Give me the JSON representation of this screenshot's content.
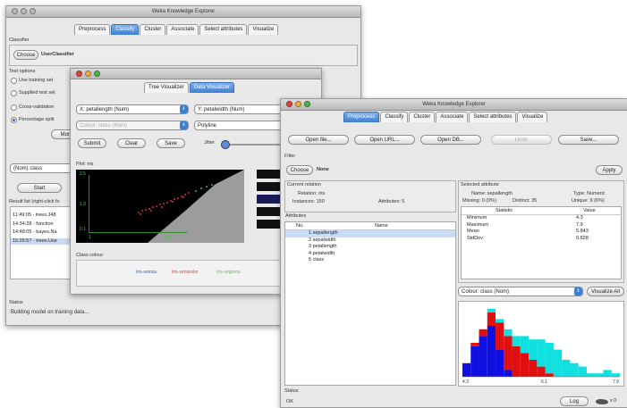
{
  "back_window": {
    "title": "Weka Knowledge Explorer",
    "tabs": [
      "Preprocess",
      "Classify",
      "Cluster",
      "Associate",
      "Select attributes",
      "Visualize"
    ],
    "active_tab": "Classify",
    "classifier_label": "Classifier",
    "choose_label": "Choose",
    "classifier_name": "UserClassifier",
    "test_options_label": "Test options",
    "test_options": [
      "Use training set",
      "Supplied test set",
      "Cross-validation",
      "Percentage split"
    ],
    "more_label": "More o",
    "class_select": "(Nom) class",
    "start_label": "Start",
    "result_list_label": "Result list (right-click fo",
    "results": [
      "11:49:05 - trees.J48",
      "14:34:28 - function",
      "14:48:05 - bayes.Na",
      "15:26:57 - trees.Use"
    ],
    "status_label": "Status",
    "status_text": "Building model on training data..."
  },
  "visualizer_window": {
    "tabs": [
      "Tree Visualizer",
      "Data Visualizer"
    ],
    "active_tab": "Data Visualizer",
    "x_select": "X: petallength (Num)",
    "y_select": "Y: petalwidth (Num)",
    "colour_select": "Colour: class (Nom)",
    "shape_select": "Polyline",
    "submit_label": "Submit",
    "clear_label": "Clear",
    "save_label": "Save",
    "jitter_label": "Jitter",
    "plot_label": "Plot: iris",
    "y_ticks": [
      "2.5",
      "1.3",
      "0.1"
    ],
    "x_ticks": [
      "1",
      "3.95"
    ],
    "class_colour_label": "Class colour",
    "class_names": [
      "Iris-setosa",
      "Iris-versicolor",
      "Iris-virginica"
    ],
    "class_colors": [
      "#3060d0",
      "#e04040",
      "#60c060"
    ]
  },
  "front_window": {
    "title": "Weka Knowledge Explorer",
    "tabs": [
      "Preprocess",
      "Classify",
      "Cluster",
      "Associate",
      "Select attributes",
      "Visualize"
    ],
    "active_tab": "Preprocess",
    "open_file": "Open file...",
    "open_url": "Open URL...",
    "open_db": "Open DB...",
    "undo": "Undo",
    "save": "Save...",
    "filter_label": "Filter",
    "choose_label": "Choose",
    "filter_value": "None",
    "apply_label": "Apply",
    "current_relation": {
      "header": "Current relation",
      "relation": "Relation: iris",
      "instances": "Instances: 150",
      "attributes": "Attributes: 5"
    },
    "attributes_header": "Attributes",
    "attr_columns": [
      "No.",
      "Name"
    ],
    "attributes": [
      "1 sepallength",
      "2 sepalwidth",
      "3 petallength",
      "4 petalwidth",
      "5 class"
    ],
    "selected_attribute": {
      "header": "Selected attribute",
      "name": "Name: sepallength",
      "missing": "Missing: 0 (0%)",
      "distinct": "Distinct: 35",
      "type": "Type: Numeric",
      "unique": "Unique: 9 (6%)"
    },
    "stats_columns": [
      "Statistic",
      "Value"
    ],
    "stats": [
      {
        "stat": "Minimum",
        "value": "4.3"
      },
      {
        "stat": "Maximum",
        "value": "7.9"
      },
      {
        "stat": "Mean",
        "value": "5.843"
      },
      {
        "stat": "StdDev",
        "value": "0.828"
      }
    ],
    "colour_select": "Colour: class (Nom)",
    "visualize_all": "Visualize All",
    "hist_axis": [
      "4.3",
      "6.1",
      "7.9"
    ],
    "status_label": "Status",
    "status_text": "OK",
    "log_label": "Log",
    "x_label": "x 0"
  },
  "colors": {
    "active_tab": "#3d7fd3",
    "setosa": "#1010e0",
    "versicolor": "#e01010",
    "virginica": "#10e0e0"
  },
  "chart_data": {
    "type": "bar",
    "categories": [
      "4.3",
      "4.5",
      "4.7",
      "4.9",
      "5.1",
      "5.3",
      "5.5",
      "5.7",
      "5.9",
      "6.1",
      "6.3",
      "6.5",
      "6.7",
      "6.9",
      "7.1",
      "7.3",
      "7.5",
      "7.7",
      "7.9"
    ],
    "series": [
      {
        "values": [
          4,
          9,
          12,
          15,
          8,
          2,
          0,
          0,
          0,
          0,
          0,
          0,
          0,
          0,
          0,
          0,
          0,
          0,
          0
        ]
      },
      {
        "values": [
          0,
          1,
          2,
          4,
          8,
          10,
          9,
          7,
          5,
          3,
          1,
          0,
          0,
          0,
          0,
          0,
          0,
          0,
          0
        ]
      },
      {
        "values": [
          0,
          0,
          0,
          1,
          1,
          2,
          3,
          5,
          6,
          8,
          9,
          8,
          5,
          4,
          3,
          1,
          1,
          2,
          1
        ]
      }
    ],
    "xlabel": "",
    "ylabel": ""
  }
}
